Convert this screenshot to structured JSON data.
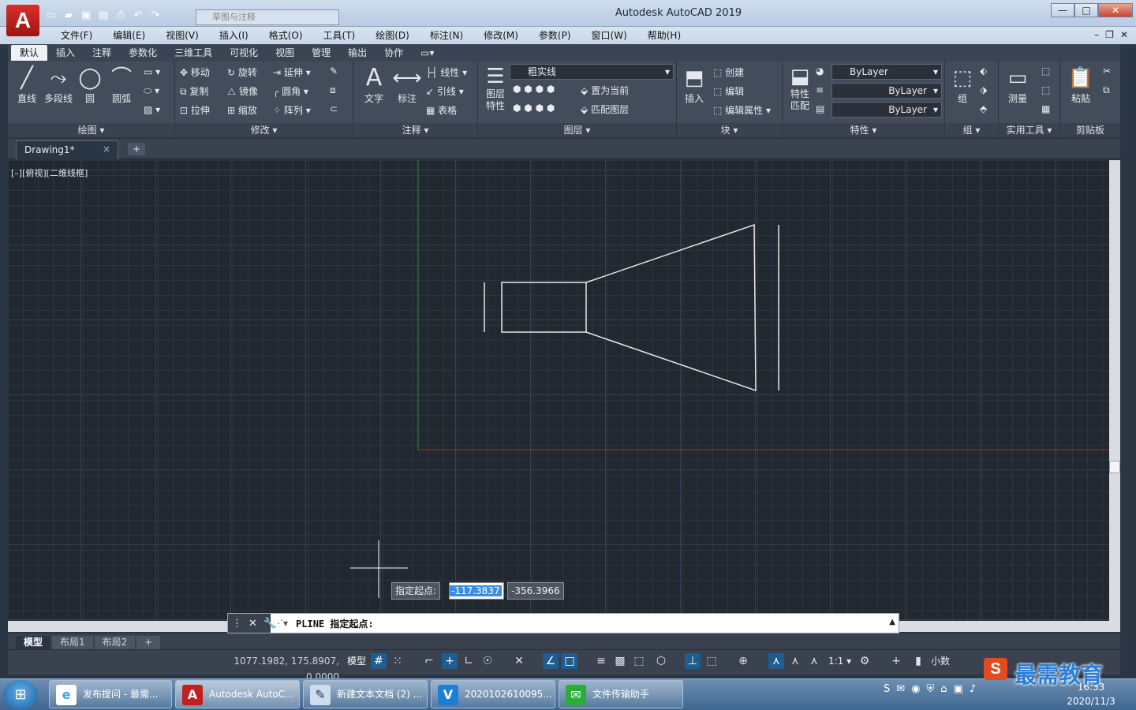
{
  "app": {
    "title": "Autodesk AutoCAD 2019",
    "logo": "A",
    "workspace_placeholder": "草图与注释"
  },
  "window_controls": {
    "minimize": "▭",
    "maximize": "□",
    "close": "✕"
  },
  "menubar": [
    "文件(F)",
    "编辑(E)",
    "视图(V)",
    "插入(I)",
    "格式(O)",
    "工具(T)",
    "绘图(D)",
    "标注(N)",
    "修改(M)",
    "参数(P)",
    "窗口(W)",
    "帮助(H)"
  ],
  "ribbon_tabs": [
    "默认",
    "插入",
    "注释",
    "参数化",
    "三维工具",
    "可视化",
    "视图",
    "管理",
    "输出",
    "协作"
  ],
  "ribbon": {
    "draw": {
      "title": "绘图 ▾",
      "line": "直线",
      "polyline": "多段线",
      "circle": "圆",
      "arc": "圆弧"
    },
    "modify": {
      "title": "修改 ▾",
      "move": "移动",
      "rotate": "旋转",
      "extend": "延伸",
      "copy": "复制",
      "mirror": "镜像",
      "fillet": "圆角",
      "stretch": "拉伸",
      "scale": "缩放",
      "array": "阵列"
    },
    "annotation": {
      "title": "注释 ▾",
      "text": "文字",
      "dimension": "标注",
      "linear": "线性",
      "leader": "引线",
      "table": "表格"
    },
    "layers": {
      "title": "图层 ▾",
      "layer_props": "图层\n特性",
      "current_layer": "粗实线",
      "set_current": "置为当前",
      "match_layer": "匹配图层"
    },
    "block": {
      "title": "块 ▾",
      "insert": "插入",
      "create": "创建",
      "edit": "编辑",
      "edit_attr": "编辑属性"
    },
    "properties": {
      "title": "特性 ▾",
      "match": "特性\n匹配",
      "color": "ByLayer",
      "linetype": "ByLayer",
      "lineweight": "ByLayer"
    },
    "groups": {
      "title": "组 ▾",
      "group": "组"
    },
    "utilities": {
      "title": "实用工具 ▾",
      "measure": "测量"
    },
    "clipboard": {
      "title": "剪贴板",
      "paste": "粘贴"
    }
  },
  "doc_tab": {
    "name": "Drawing1*",
    "close": "×",
    "new": "+"
  },
  "viewport_label": "[–][俯视][二维线框]",
  "dynamic_input": {
    "label": "指定起点:",
    "x": "-117.3837",
    "y": "-356.3966"
  },
  "command_line": {
    "prompt": "PLINE 指定起点:"
  },
  "layout_tabs": [
    "模型",
    "布局1",
    "布局2",
    "+"
  ],
  "status": {
    "coords": "1077.1982, 175.8907, 0.0000",
    "model": "模型",
    "scale": "1:1 ▾",
    "units": "小数"
  },
  "taskbar": {
    "items": [
      {
        "label": "发布提问 - 最需...",
        "icon": "e"
      },
      {
        "label": "Autodesk AutoC...",
        "icon": "A"
      },
      {
        "label": "新建文本文档 (2) ...",
        "icon": "✎"
      },
      {
        "label": "2020102610095...",
        "icon": "V"
      },
      {
        "label": "文件传输助手",
        "icon": "✉"
      }
    ],
    "clock_time": "16:33",
    "clock_date": "2020/11/3"
  },
  "watermark": {
    "text": "最需教育",
    "logo": "S"
  },
  "colors": {
    "canvas_bg": "#212830",
    "ribbon_bg": "#434c5b",
    "x_axis": "#b02c2c",
    "y_axis": "#2e8a3a",
    "geometry": "#e8e8e8"
  }
}
